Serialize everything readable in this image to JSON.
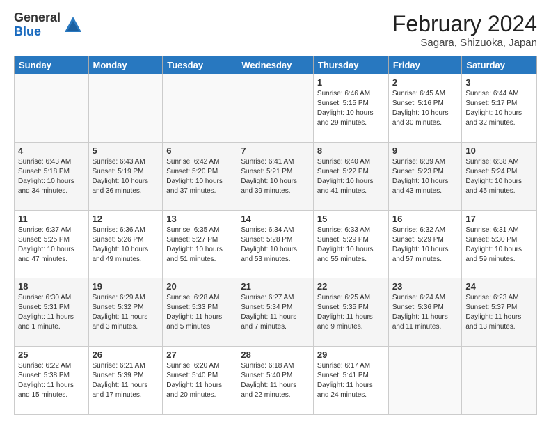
{
  "header": {
    "logo_general": "General",
    "logo_blue": "Blue",
    "month_title": "February 2024",
    "location": "Sagara, Shizuoka, Japan"
  },
  "days_of_week": [
    "Sunday",
    "Monday",
    "Tuesday",
    "Wednesday",
    "Thursday",
    "Friday",
    "Saturday"
  ],
  "weeks": [
    [
      {
        "day": "",
        "info": ""
      },
      {
        "day": "",
        "info": ""
      },
      {
        "day": "",
        "info": ""
      },
      {
        "day": "",
        "info": ""
      },
      {
        "day": "1",
        "info": "Sunrise: 6:46 AM\nSunset: 5:15 PM\nDaylight: 10 hours and 29 minutes."
      },
      {
        "day": "2",
        "info": "Sunrise: 6:45 AM\nSunset: 5:16 PM\nDaylight: 10 hours and 30 minutes."
      },
      {
        "day": "3",
        "info": "Sunrise: 6:44 AM\nSunset: 5:17 PM\nDaylight: 10 hours and 32 minutes."
      }
    ],
    [
      {
        "day": "4",
        "info": "Sunrise: 6:43 AM\nSunset: 5:18 PM\nDaylight: 10 hours and 34 minutes."
      },
      {
        "day": "5",
        "info": "Sunrise: 6:43 AM\nSunset: 5:19 PM\nDaylight: 10 hours and 36 minutes."
      },
      {
        "day": "6",
        "info": "Sunrise: 6:42 AM\nSunset: 5:20 PM\nDaylight: 10 hours and 37 minutes."
      },
      {
        "day": "7",
        "info": "Sunrise: 6:41 AM\nSunset: 5:21 PM\nDaylight: 10 hours and 39 minutes."
      },
      {
        "day": "8",
        "info": "Sunrise: 6:40 AM\nSunset: 5:22 PM\nDaylight: 10 hours and 41 minutes."
      },
      {
        "day": "9",
        "info": "Sunrise: 6:39 AM\nSunset: 5:23 PM\nDaylight: 10 hours and 43 minutes."
      },
      {
        "day": "10",
        "info": "Sunrise: 6:38 AM\nSunset: 5:24 PM\nDaylight: 10 hours and 45 minutes."
      }
    ],
    [
      {
        "day": "11",
        "info": "Sunrise: 6:37 AM\nSunset: 5:25 PM\nDaylight: 10 hours and 47 minutes."
      },
      {
        "day": "12",
        "info": "Sunrise: 6:36 AM\nSunset: 5:26 PM\nDaylight: 10 hours and 49 minutes."
      },
      {
        "day": "13",
        "info": "Sunrise: 6:35 AM\nSunset: 5:27 PM\nDaylight: 10 hours and 51 minutes."
      },
      {
        "day": "14",
        "info": "Sunrise: 6:34 AM\nSunset: 5:28 PM\nDaylight: 10 hours and 53 minutes."
      },
      {
        "day": "15",
        "info": "Sunrise: 6:33 AM\nSunset: 5:29 PM\nDaylight: 10 hours and 55 minutes."
      },
      {
        "day": "16",
        "info": "Sunrise: 6:32 AM\nSunset: 5:29 PM\nDaylight: 10 hours and 57 minutes."
      },
      {
        "day": "17",
        "info": "Sunrise: 6:31 AM\nSunset: 5:30 PM\nDaylight: 10 hours and 59 minutes."
      }
    ],
    [
      {
        "day": "18",
        "info": "Sunrise: 6:30 AM\nSunset: 5:31 PM\nDaylight: 11 hours and 1 minute."
      },
      {
        "day": "19",
        "info": "Sunrise: 6:29 AM\nSunset: 5:32 PM\nDaylight: 11 hours and 3 minutes."
      },
      {
        "day": "20",
        "info": "Sunrise: 6:28 AM\nSunset: 5:33 PM\nDaylight: 11 hours and 5 minutes."
      },
      {
        "day": "21",
        "info": "Sunrise: 6:27 AM\nSunset: 5:34 PM\nDaylight: 11 hours and 7 minutes."
      },
      {
        "day": "22",
        "info": "Sunrise: 6:25 AM\nSunset: 5:35 PM\nDaylight: 11 hours and 9 minutes."
      },
      {
        "day": "23",
        "info": "Sunrise: 6:24 AM\nSunset: 5:36 PM\nDaylight: 11 hours and 11 minutes."
      },
      {
        "day": "24",
        "info": "Sunrise: 6:23 AM\nSunset: 5:37 PM\nDaylight: 11 hours and 13 minutes."
      }
    ],
    [
      {
        "day": "25",
        "info": "Sunrise: 6:22 AM\nSunset: 5:38 PM\nDaylight: 11 hours and 15 minutes."
      },
      {
        "day": "26",
        "info": "Sunrise: 6:21 AM\nSunset: 5:39 PM\nDaylight: 11 hours and 17 minutes."
      },
      {
        "day": "27",
        "info": "Sunrise: 6:20 AM\nSunset: 5:40 PM\nDaylight: 11 hours and 20 minutes."
      },
      {
        "day": "28",
        "info": "Sunrise: 6:18 AM\nSunset: 5:40 PM\nDaylight: 11 hours and 22 minutes."
      },
      {
        "day": "29",
        "info": "Sunrise: 6:17 AM\nSunset: 5:41 PM\nDaylight: 11 hours and 24 minutes."
      },
      {
        "day": "",
        "info": ""
      },
      {
        "day": "",
        "info": ""
      }
    ]
  ]
}
